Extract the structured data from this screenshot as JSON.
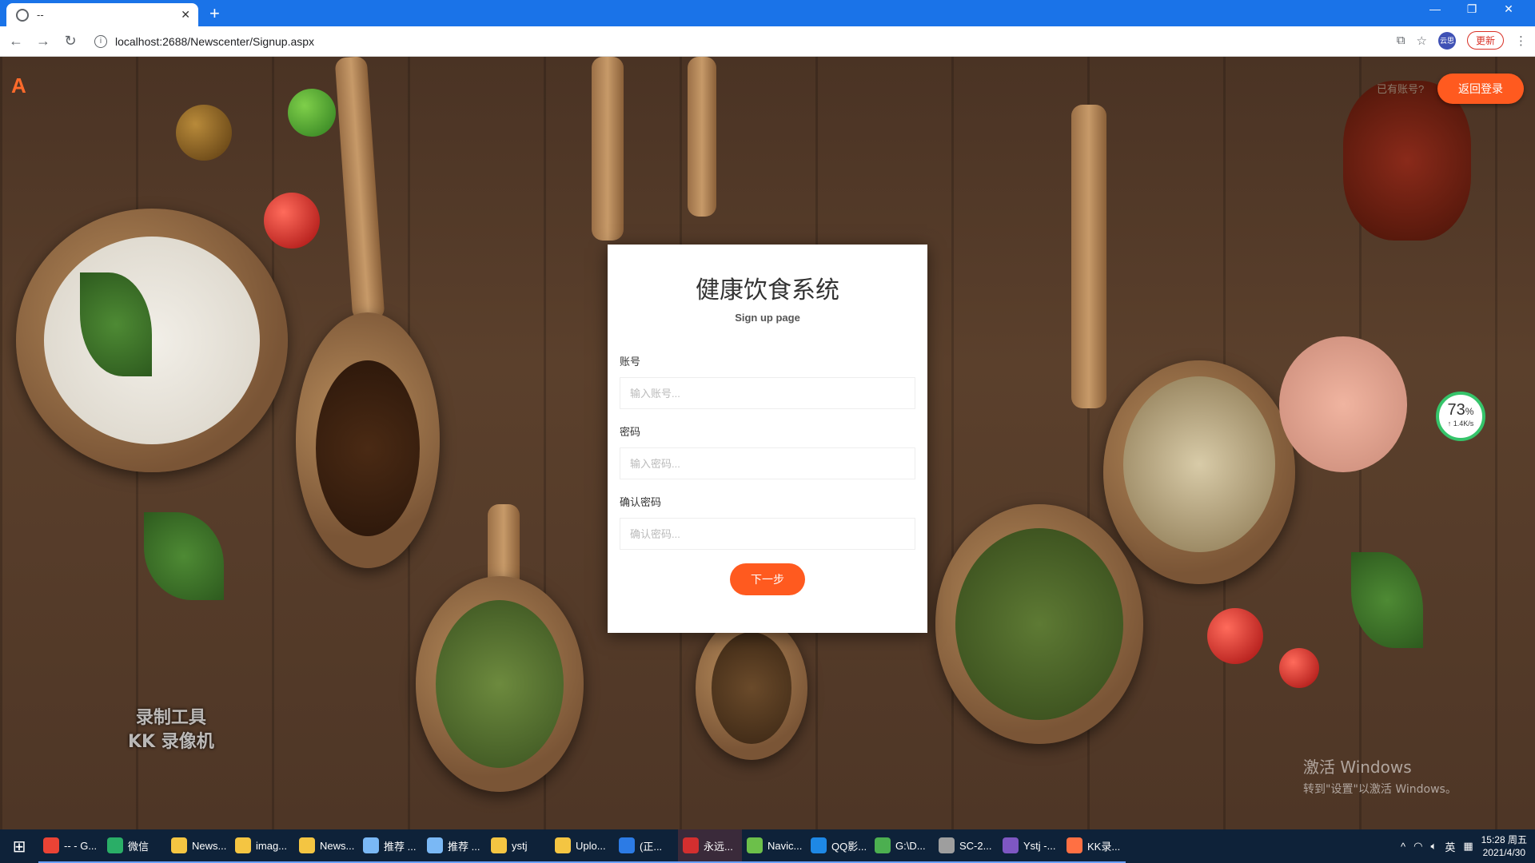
{
  "browser": {
    "tab_title": "--",
    "url": "localhost:2688/Newscenter/Signup.aspx",
    "update_label": "更新",
    "profile_initials": "云思"
  },
  "header": {
    "logo": "A",
    "have_account": "已有账号?",
    "back_login": "返回登录"
  },
  "form": {
    "title": "健康饮食系统",
    "subtitle": "Sign up page",
    "account_label": "账号",
    "account_placeholder": "输入账号...",
    "password_label": "密码",
    "password_placeholder": "输入密码...",
    "confirm_label": "确认密码",
    "confirm_placeholder": "确认密码...",
    "next_label": "下一步"
  },
  "speed_widget": {
    "percent": "73",
    "percent_unit": "%",
    "rate": "↑ 1.4K/s"
  },
  "watermark": {
    "line1": "录制工具",
    "line2": "KK 录像机"
  },
  "activate": {
    "line1": "激活 Windows",
    "line2": "转到\"设置\"以激活 Windows。"
  },
  "taskbar": {
    "items": [
      {
        "label": "-- - G...",
        "color": "#ea4335"
      },
      {
        "label": "微信",
        "color": "#2aae67"
      },
      {
        "label": "News...",
        "color": "#f4c542"
      },
      {
        "label": "imag...",
        "color": "#f4c542"
      },
      {
        "label": "News...",
        "color": "#f4c542"
      },
      {
        "label": "推荐 ...",
        "color": "#7ab8f5"
      },
      {
        "label": "推荐 ...",
        "color": "#7ab8f5"
      },
      {
        "label": "ystj",
        "color": "#f4c542"
      },
      {
        "label": "Uplo...",
        "color": "#f4c542"
      },
      {
        "label": "(正...",
        "color": "#2c7be5"
      },
      {
        "label": "永远...",
        "color": "#d32f2f"
      },
      {
        "label": "Navic...",
        "color": "#6cc04a"
      },
      {
        "label": "QQ影...",
        "color": "#1e88e5"
      },
      {
        "label": "G:\\D...",
        "color": "#4caf50"
      },
      {
        "label": "SC-2...",
        "color": "#9e9e9e"
      },
      {
        "label": "Ystj -...",
        "color": "#7e57c2"
      },
      {
        "label": "KK录...",
        "color": "#ff7043"
      }
    ],
    "ime": "英",
    "time": "15:28 周五",
    "date": "2021/4/30"
  }
}
